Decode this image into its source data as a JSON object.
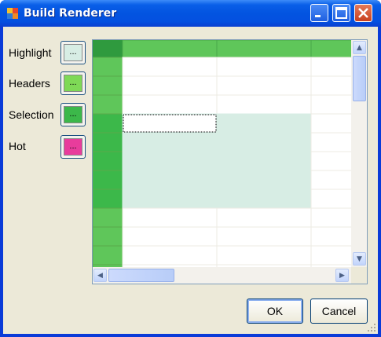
{
  "window": {
    "title": "Build Renderer"
  },
  "options": [
    {
      "label": "Highlight",
      "button_label": "...",
      "color": "#d7ede4"
    },
    {
      "label": "Headers",
      "button_label": "...",
      "color": "#7ed956"
    },
    {
      "label": "Selection",
      "button_label": "...",
      "color": "#3cb84a"
    },
    {
      "label": "Hot",
      "button_label": "...",
      "color": "#e83c9c"
    }
  ],
  "grid": {
    "header_color": "#5fc65a",
    "selected_header_color": "#3cb84a",
    "highlight_color": "#d7ede4",
    "visible_rows": 12,
    "visible_columns": 3,
    "selected_rows": [
      3,
      4,
      5,
      6,
      7
    ],
    "selected_columns": [
      1,
      2
    ],
    "current_cell": {
      "row": 3,
      "column": 1
    }
  },
  "buttons": {
    "ok_label": "OK",
    "cancel_label": "Cancel"
  }
}
